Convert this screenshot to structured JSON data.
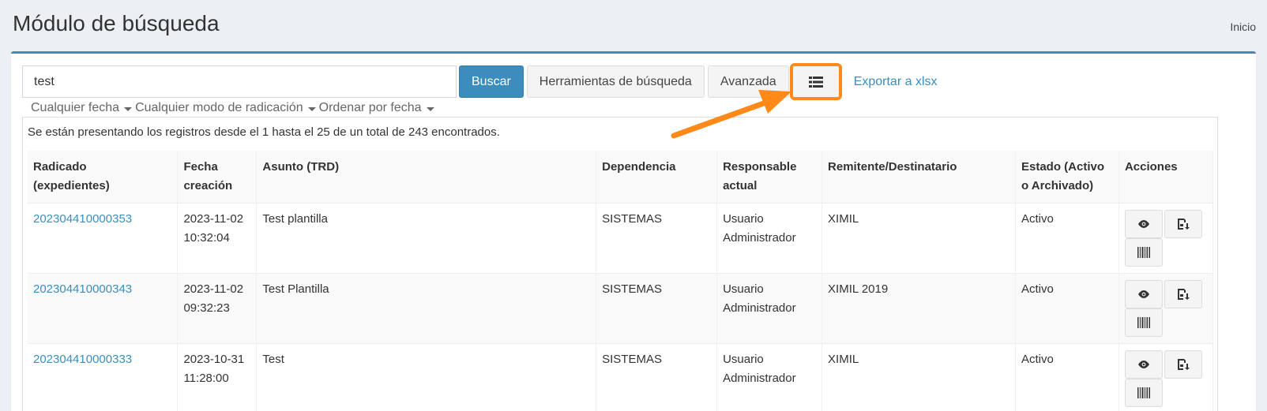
{
  "header": {
    "title": "Módulo de búsqueda",
    "home_link": "Inicio"
  },
  "search": {
    "value": "test",
    "buscar_label": "Buscar",
    "tools_label": "Herramientas de búsqueda",
    "advanced_label": "Avanzada",
    "export_label": "Exportar a xlsx"
  },
  "filters": {
    "date": "Cualquier fecha",
    "mode": "Cualquier modo de radicación",
    "order": "Ordenar por fecha"
  },
  "summary": "Se están presentando los registros desde el 1 hasta el 25 de un total de 243 encontrados.",
  "table": {
    "headers": {
      "radicado_1": "Radicado",
      "radicado_2": "(expedientes)",
      "fecha_1": "Fecha",
      "fecha_2": "creación",
      "asunto": "Asunto (TRD)",
      "dependencia": "Dependencia",
      "responsable_1": "Responsable",
      "responsable_2": "actual",
      "remitente": "Remitente/Destinatario",
      "estado_1": "Estado (Activo",
      "estado_2": "o Archivado)",
      "acciones": "Acciones"
    },
    "rows": [
      {
        "radicado": "202304410000353",
        "fecha": "2023-11-02",
        "hora": "10:32:04",
        "asunto": "Test plantilla",
        "dependencia": "SISTEMAS",
        "resp_1": "Usuario",
        "resp_2": "Administrador",
        "remitente": "XIMIL",
        "estado": "Activo"
      },
      {
        "radicado": "202304410000343",
        "fecha": "2023-11-02",
        "hora": "09:32:23",
        "asunto": "Test Plantilla",
        "dependencia": "SISTEMAS",
        "resp_1": "Usuario",
        "resp_2": "Administrador",
        "remitente": "XIMIL 2019",
        "estado": "Activo"
      },
      {
        "radicado": "202304410000333",
        "fecha": "2023-10-31",
        "hora": "11:28:00",
        "asunto": "Test",
        "dependencia": "SISTEMAS",
        "resp_1": "Usuario",
        "resp_2": "Administrador",
        "remitente": "XIMIL",
        "estado": "Activo"
      }
    ]
  },
  "colors": {
    "accent": "#3c8dbc",
    "highlight": "#ff8a1a"
  },
  "icons": [
    "list-icon",
    "eye-icon",
    "save-export-icon",
    "barcode-icon"
  ]
}
